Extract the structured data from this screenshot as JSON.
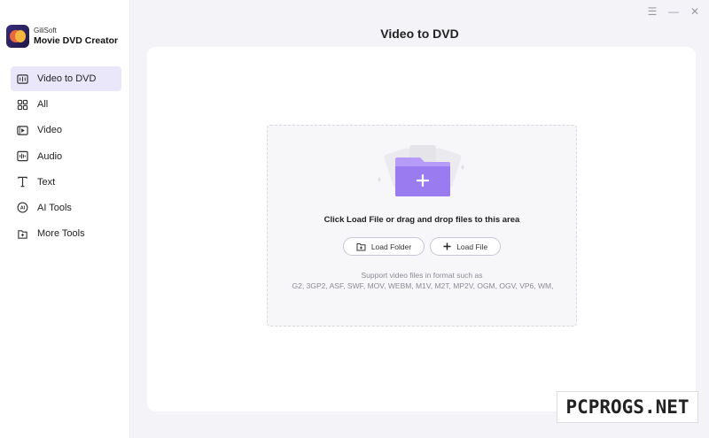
{
  "app": {
    "brand_small": "GiliSoft",
    "brand_name": "Movie DVD Creator"
  },
  "window": {
    "title": "Video to DVD",
    "controls": [
      "menu-icon",
      "minimize-icon",
      "close-icon"
    ]
  },
  "sidebar": {
    "items": [
      {
        "label": "Video to DVD",
        "icon": "video-to-dvd-icon",
        "active": true
      },
      {
        "label": "All",
        "icon": "grid-icon"
      },
      {
        "label": "Video",
        "icon": "video-icon"
      },
      {
        "label": "Audio",
        "icon": "audio-icon"
      },
      {
        "label": "Text",
        "icon": "text-icon"
      },
      {
        "label": "AI Tools",
        "icon": "ai-icon"
      },
      {
        "label": "More Tools",
        "icon": "more-tools-icon"
      }
    ]
  },
  "dropzone": {
    "prompt": "Click Load File or drag and drop files to this area",
    "load_folder_label": "Load Folder",
    "load_file_label": "Load File",
    "support_text": "Support video files in format such as",
    "formats_text": "G2,  3GP2,  ASF,  SWF,  MOV,  WEBM,  M1V,  M2T,  MP2V,  OGM,  OGV,  VP6,  WM,"
  },
  "colors": {
    "accent": "#9b7cf0",
    "active_bg": "#ebe7fb",
    "background": "#f4f4f8"
  },
  "watermark": {
    "text": "PCPROGS.NET"
  }
}
